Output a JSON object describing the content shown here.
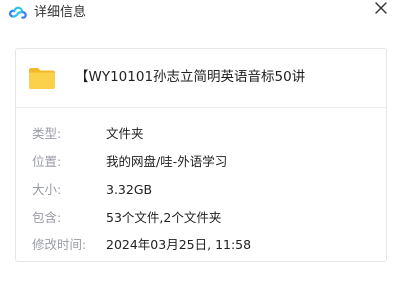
{
  "window": {
    "title": "详细信息",
    "logo_icon": "baidu-netdisk-cloud-icon",
    "close_icon": "close-icon"
  },
  "file": {
    "name": "【WY10101孙志立简明英语音标50讲",
    "icon": "folder-icon",
    "icon_color": "#f7c43c"
  },
  "details": [
    {
      "label": "类型:",
      "value": "文件夹"
    },
    {
      "label": "位置:",
      "value": "我的网盘/哇-外语学习"
    },
    {
      "label": "大小:",
      "value": "3.32GB"
    },
    {
      "label": "包含:",
      "value": "53个文件,2个文件夹"
    },
    {
      "label": "修改时间:",
      "value": "2024年03月25日, 11:58"
    }
  ]
}
